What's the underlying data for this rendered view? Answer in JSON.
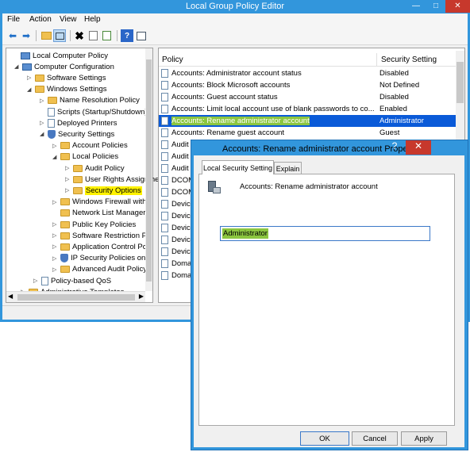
{
  "window": {
    "title": "Local Group Policy Editor",
    "min_glyph": "—",
    "max_glyph": "□",
    "close_glyph": "✕"
  },
  "menu": [
    "File",
    "Action",
    "View",
    "Help"
  ],
  "toolbar_icons": [
    "back-icon",
    "forward-icon",
    "up-folder-icon",
    "show-hide-tree-icon",
    "delete-icon",
    "properties-icon",
    "export-list-icon",
    "help-icon",
    "console-icon"
  ],
  "tree": [
    {
      "label": "Local Computer Policy",
      "icon": "computer",
      "arrow": ""
    },
    {
      "label": "Computer Configuration",
      "icon": "computer",
      "arrow": "◢"
    },
    {
      "label": "Software Settings",
      "icon": "folder",
      "arrow": "▷"
    },
    {
      "label": "Windows Settings",
      "icon": "folder",
      "arrow": "◢"
    },
    {
      "label": "Name Resolution Policy",
      "icon": "folder",
      "arrow": "▷"
    },
    {
      "label": "Scripts (Startup/Shutdown)",
      "icon": "doc",
      "arrow": ""
    },
    {
      "label": "Deployed Printers",
      "icon": "doc",
      "arrow": "▷"
    },
    {
      "label": "Security Settings",
      "icon": "shield",
      "arrow": "◢"
    },
    {
      "label": "Account Policies",
      "icon": "folder",
      "arrow": "▷"
    },
    {
      "label": "Local Policies",
      "icon": "folder",
      "arrow": "◢"
    },
    {
      "label": "Audit Policy",
      "icon": "folder",
      "arrow": "▷"
    },
    {
      "label": "User Rights Assignment",
      "icon": "folder",
      "arrow": "▷"
    },
    {
      "label": "Security Options",
      "icon": "folder",
      "arrow": "▷"
    },
    {
      "label": "Windows Firewall with",
      "icon": "folder",
      "arrow": "▷"
    },
    {
      "label": "Network List Manager P",
      "icon": "folder",
      "arrow": ""
    },
    {
      "label": "Public Key Policies",
      "icon": "folder",
      "arrow": "▷"
    },
    {
      "label": "Software Restriction Po",
      "icon": "folder",
      "arrow": "▷"
    },
    {
      "label": "Application Control Po",
      "icon": "folder",
      "arrow": "▷"
    },
    {
      "label": "IP Security Policies on L",
      "icon": "shield",
      "arrow": "▷"
    },
    {
      "label": "Advanced Audit Policy",
      "icon": "folder",
      "arrow": "▷"
    },
    {
      "label": "Policy-based QoS",
      "icon": "doc",
      "arrow": "▷"
    },
    {
      "label": "Administrative Templates",
      "icon": "folder",
      "arrow": "▷"
    }
  ],
  "list": {
    "col_policy": "Policy",
    "col_setting": "Security Setting",
    "rows": [
      {
        "policy": "Accounts: Administrator account status",
        "setting": "Disabled"
      },
      {
        "policy": "Accounts: Block Microsoft accounts",
        "setting": "Not Defined"
      },
      {
        "policy": "Accounts: Guest account status",
        "setting": "Disabled"
      },
      {
        "policy": "Accounts: Limit local account use of blank passwords to co...",
        "setting": "Enabled"
      },
      {
        "policy": "Accounts: Rename administrator account",
        "setting": "Administrator"
      },
      {
        "policy": "Accounts: Rename guest account",
        "setting": "Guest"
      },
      {
        "policy": "Audit",
        "setting": ""
      },
      {
        "policy": "Audit",
        "setting": ""
      },
      {
        "policy": "Audit",
        "setting": ""
      },
      {
        "policy": "DCOM",
        "setting": ""
      },
      {
        "policy": "DCOM",
        "setting": ""
      },
      {
        "policy": "Device",
        "setting": ""
      },
      {
        "policy": "Device",
        "setting": ""
      },
      {
        "policy": "Device",
        "setting": ""
      },
      {
        "policy": "Device",
        "setting": ""
      },
      {
        "policy": "Device",
        "setting": ""
      },
      {
        "policy": "Domai",
        "setting": ""
      },
      {
        "policy": "Domai",
        "setting": ""
      }
    ]
  },
  "dialog": {
    "title": "Accounts: Rename administrator account Properties",
    "help_glyph": "?",
    "close_glyph": "✕",
    "tabs": [
      "Local Security Setting",
      "Explain"
    ],
    "policy_name": "Accounts: Rename administrator account",
    "input_value": "Administrator",
    "ok": "OK",
    "cancel": "Cancel",
    "apply": "Apply"
  },
  "colors": {
    "accent": "#3296dc",
    "selection": "#0a5ad8",
    "highlight_yellow": "#fff200",
    "highlight_green": "#8cc640",
    "close_red": "#c7382c"
  }
}
